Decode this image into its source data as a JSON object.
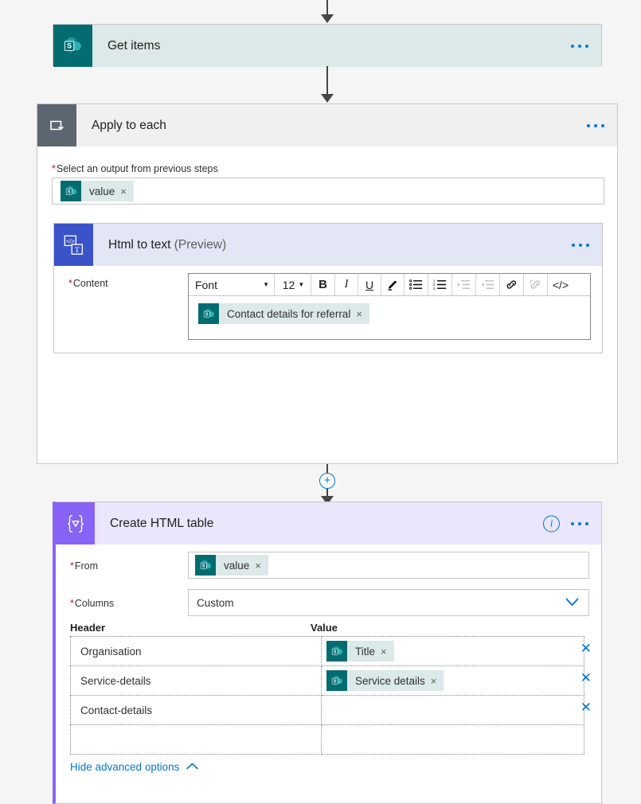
{
  "connectors": {
    "plus_label": "+"
  },
  "cards": [
    {
      "id": "get-items",
      "title": "Get items",
      "icon": "sharepoint-icon",
      "menu": "more-commands"
    },
    {
      "id": "apply-to-each",
      "title": "Apply to each",
      "icon": "loop-icon",
      "field_label": "Select an output from previous steps",
      "required_mark": "*",
      "token": {
        "text": "value",
        "remove": "×",
        "icon": "sharepoint-icon"
      }
    },
    {
      "id": "html-to-text",
      "title": "Html to text",
      "title_suffix": "(Preview)",
      "icon": "html-to-text-icon",
      "content_label": "Content",
      "required_mark": "*",
      "token": {
        "text": "Contact details for referral",
        "remove": "×",
        "icon": "sharepoint-icon"
      }
    },
    {
      "id": "create-html-table",
      "title": "Create HTML table",
      "icon": "data-operations-icon"
    }
  ],
  "rich_text_toolbar": {
    "font_name": "Font",
    "font_size": "12",
    "caret": "▼",
    "buttons": [
      {
        "name": "bold-icon",
        "glyph": "B",
        "disabled": false
      },
      {
        "name": "italic-icon",
        "glyph": "I",
        "disabled": false
      },
      {
        "name": "underline-icon",
        "glyph": "U",
        "disabled": false
      },
      {
        "name": "highlighter-icon",
        "glyph": "✐",
        "disabled": false
      },
      {
        "name": "bulleted-list-icon",
        "glyph": "☰",
        "disabled": false
      },
      {
        "name": "numbered-list-icon",
        "glyph": "☰",
        "disabled": false
      },
      {
        "name": "indent-icon",
        "glyph": "☰",
        "disabled": true
      },
      {
        "name": "outdent-icon",
        "glyph": "☰",
        "disabled": true
      },
      {
        "name": "link-icon",
        "glyph": "🔗",
        "disabled": false
      },
      {
        "name": "unlink-icon",
        "glyph": "🔗",
        "disabled": true
      },
      {
        "name": "code-view-icon",
        "glyph": "</>",
        "disabled": false
      }
    ]
  },
  "add_action": {
    "label": "Add an action",
    "icon": "add-action-icon"
  },
  "create_table": {
    "from_label": "From",
    "from_required": "*",
    "from_token": {
      "text": "value",
      "remove": "×",
      "icon": "sharepoint-icon"
    },
    "columns_label": "Columns",
    "columns_required": "*",
    "columns_value": "Custom",
    "columns_caret": "⌄",
    "grid": {
      "header_col": "Header",
      "value_col": "Value",
      "rows": [
        {
          "header": "Organisation",
          "value_token": {
            "text": "Title",
            "remove": "×"
          },
          "delete": "✕"
        },
        {
          "header": "Service-details",
          "value_token": {
            "text": "Service details",
            "remove": "×"
          },
          "delete": "✕"
        },
        {
          "header": "Contact-details",
          "value_token": null,
          "delete": "✕"
        },
        {
          "header": "",
          "value_token": null,
          "delete": ""
        }
      ]
    },
    "advanced_link": "Hide advanced options",
    "advanced_chevron": "∧"
  },
  "colors": {
    "sharepoint_teal": "#036c70",
    "loop_gray": "#5c6670",
    "html_blue": "#3a53c8",
    "table_purple": "#8764f5",
    "accent_blue": "#0078d4",
    "required_red": "#a4262c",
    "page_bg": "#f5f5f5"
  }
}
